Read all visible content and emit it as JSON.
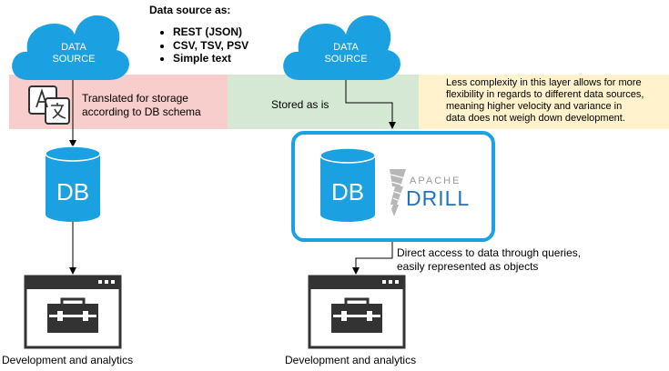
{
  "sources_heading": "Data source as:",
  "sources": [
    "REST (JSON)",
    "CSV, TSV, PSV",
    "Simple text"
  ],
  "cloud_left": {
    "line1": "DATA",
    "line2": "SOURCE"
  },
  "cloud_right": {
    "line1": "DATA",
    "line2": "SOURCE"
  },
  "band_left": {
    "line1": "Translated for storage",
    "line2": "according to DB schema"
  },
  "band_middle": {
    "text": "Stored as is"
  },
  "band_right": {
    "lines": [
      "Less complexity in this layer allows for more",
      "flexibility in regards to different data sources,",
      "meaning higher velocity and variance in",
      "data does not weigh down development."
    ]
  },
  "db_left_label": "DB",
  "db_right_label": "DB",
  "drill_logo": {
    "top": "APACHE",
    "bottom": "DRILL"
  },
  "access_note": {
    "line1": "Direct access to data through queries,",
    "line2": "easily represented as objects"
  },
  "caption_left": "Development and analytics",
  "caption_right": "Development and analytics",
  "colors": {
    "accent": "#1ba1e2",
    "band_left": "#f8cecc",
    "band_middle": "#d5e8d4",
    "band_right": "#fff2cc",
    "dark_icon": "#333333"
  },
  "icons": [
    "translate-icon",
    "cloud-icon",
    "database-icon",
    "drill-logo",
    "app-window-icon",
    "toolbox-icon"
  ]
}
